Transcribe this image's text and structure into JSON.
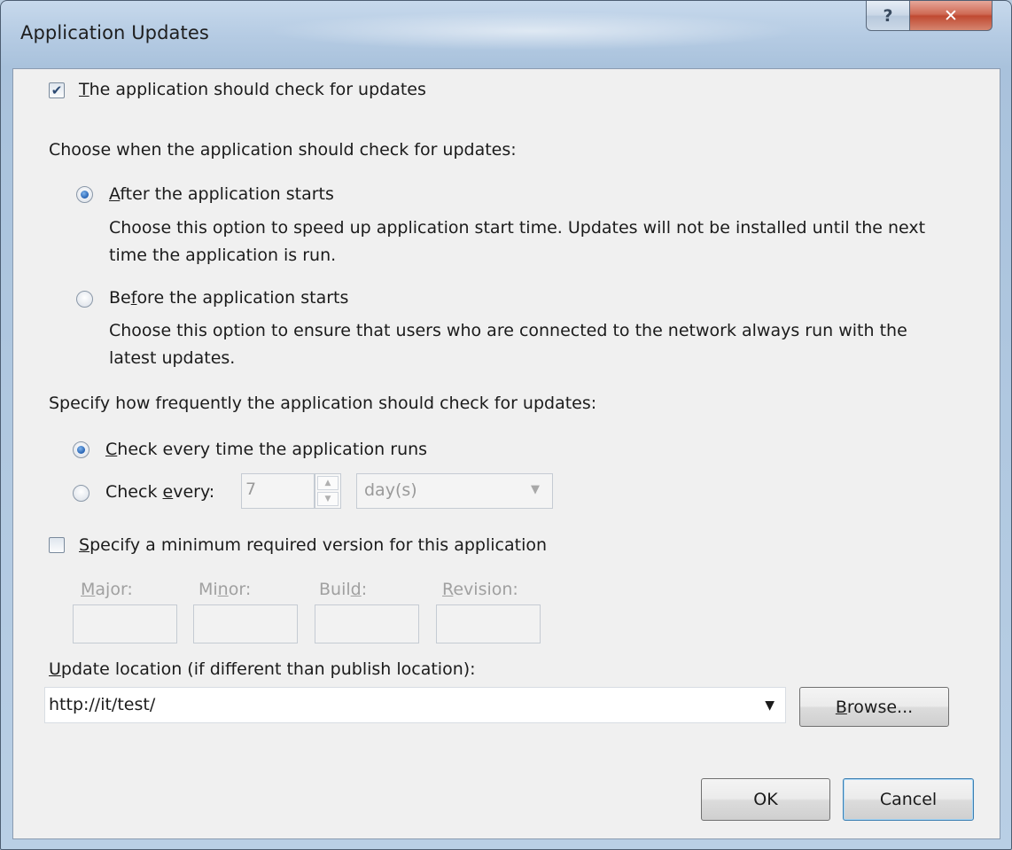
{
  "window": {
    "title": "Application Updates",
    "help_glyph": "?",
    "close_glyph": "✕"
  },
  "check_updates": {
    "checked": true,
    "label_mnemonic": "T",
    "label_rest": "he application should check for updates"
  },
  "when": {
    "heading": "Choose when the application should check for updates:",
    "after": {
      "selected": true,
      "mnemonic": "A",
      "rest": "fter the application starts",
      "description": "Choose this option to speed up application start time. Updates will not be installed until the next time the application is run."
    },
    "before": {
      "selected": false,
      "pre": "Be",
      "mnemonic": "f",
      "rest": "ore the application starts",
      "description": "Choose this option to ensure that users who are connected to the network always run with the latest updates."
    }
  },
  "frequency": {
    "heading": "Specify how frequently the application should check for updates:",
    "every_run": {
      "selected": true,
      "mnemonic": "C",
      "rest": "heck every time the application runs"
    },
    "every": {
      "selected": false,
      "pre": "Check ",
      "mnemonic": "e",
      "rest": "very:",
      "value": "7",
      "unit": "day(s)"
    }
  },
  "min_version": {
    "checked": false,
    "label_mnemonic": "S",
    "label_rest": "pecify a minimum required version for this application",
    "fields": {
      "major": {
        "pre": "",
        "mnemonic": "M",
        "rest": "ajor:"
      },
      "minor": {
        "pre": "Mi",
        "mnemonic": "n",
        "rest": "or:"
      },
      "build": {
        "pre": "Buil",
        "mnemonic": "d",
        "rest": ":"
      },
      "revision": {
        "pre": "",
        "mnemonic": "R",
        "rest": "evision:"
      }
    }
  },
  "update_location": {
    "label_mnemonic": "U",
    "label_rest": "pdate location (if different than publish location):",
    "value": "http://it/test/",
    "browse_mnemonic": "B",
    "browse_rest": "rowse..."
  },
  "buttons": {
    "ok": "OK",
    "cancel": "Cancel"
  }
}
